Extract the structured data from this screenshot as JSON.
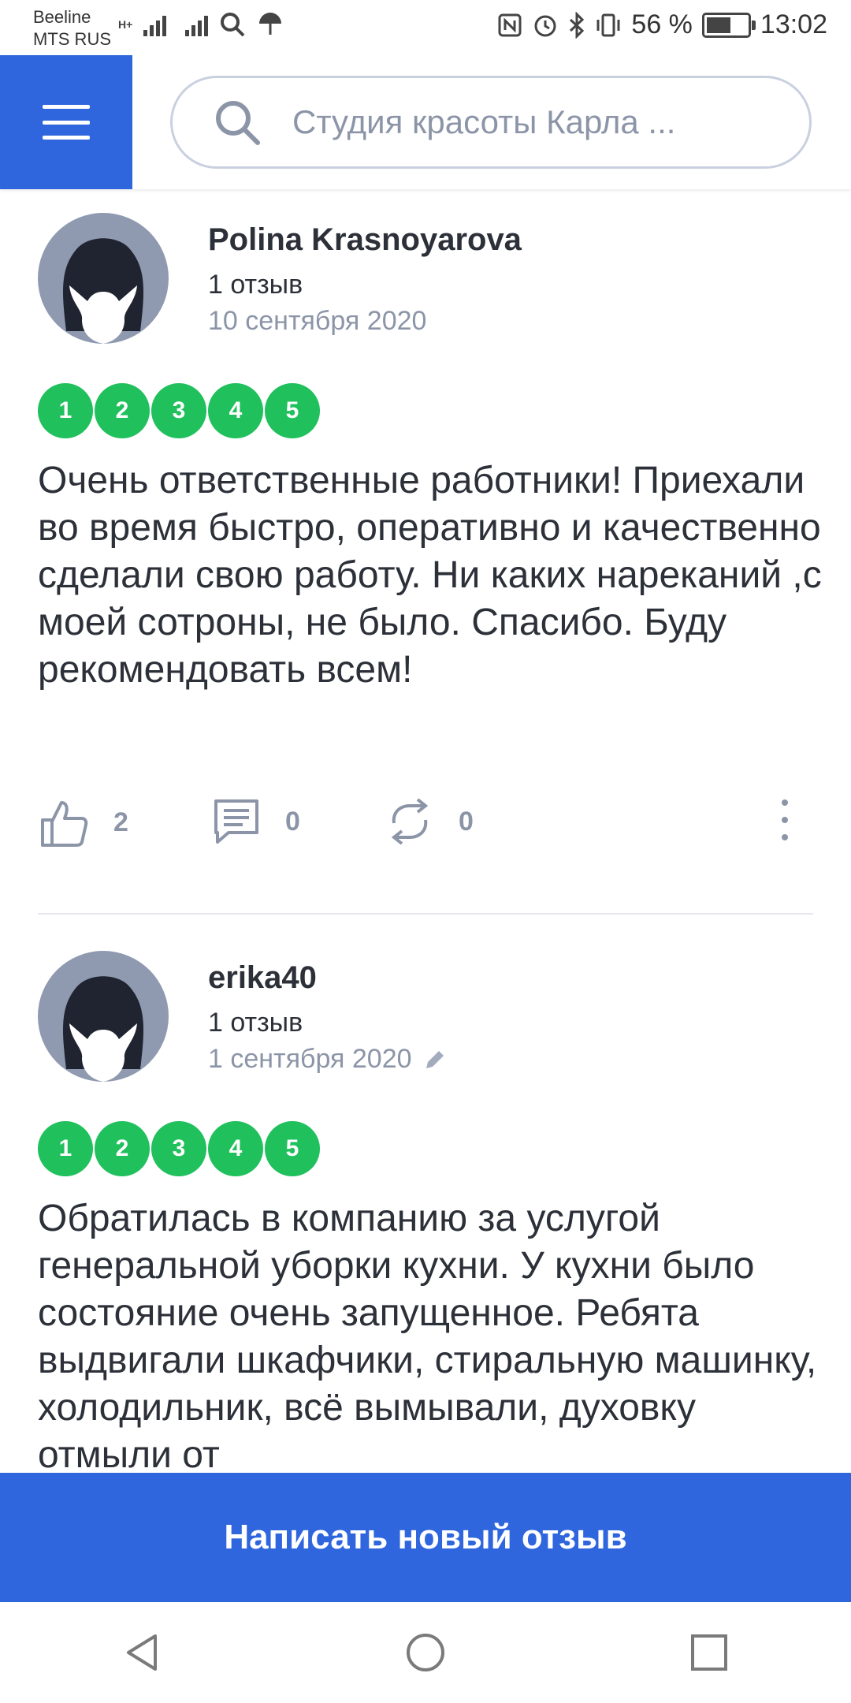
{
  "status_bar": {
    "carrier1": "Beeline",
    "carrier2": "MTS RUS",
    "network_type": "H+",
    "battery_percent": "56 %",
    "time": "13:02"
  },
  "header": {
    "search_placeholder": "Студия красоты Карла ..."
  },
  "reviews": [
    {
      "author": "Polina Krasnoyarova",
      "review_count": "1 отзыв",
      "date": "10 сентября 2020",
      "ratings": [
        "1",
        "2",
        "3",
        "4",
        "5"
      ],
      "text": "Очень ответственные работники! Приехали во время быстро, оперативно и качественно сделали свою работу. Ни каких нареканий ,с моей сотроны, не было. Спасибо. Буду рекомендовать всем!",
      "likes": "2",
      "comments": "0",
      "reposts": "0"
    },
    {
      "author": "erika40",
      "review_count": "1 отзыв",
      "date": "1 сентября 2020",
      "ratings": [
        "1",
        "2",
        "3",
        "4",
        "5"
      ],
      "text": "Обратилась в компанию за услугой генеральной уборки кухни. У кухни было состояние очень запущенное. Ребята выдвигали шкафчики, стиральную машинку, холодильник, всё вымывали, духовку отмыли от"
    }
  ],
  "write_button_label": "Написать новый отзыв",
  "colors": {
    "brand_blue": "#2f66de",
    "rating_green": "#20c05c",
    "muted_text": "#8c95a8"
  }
}
